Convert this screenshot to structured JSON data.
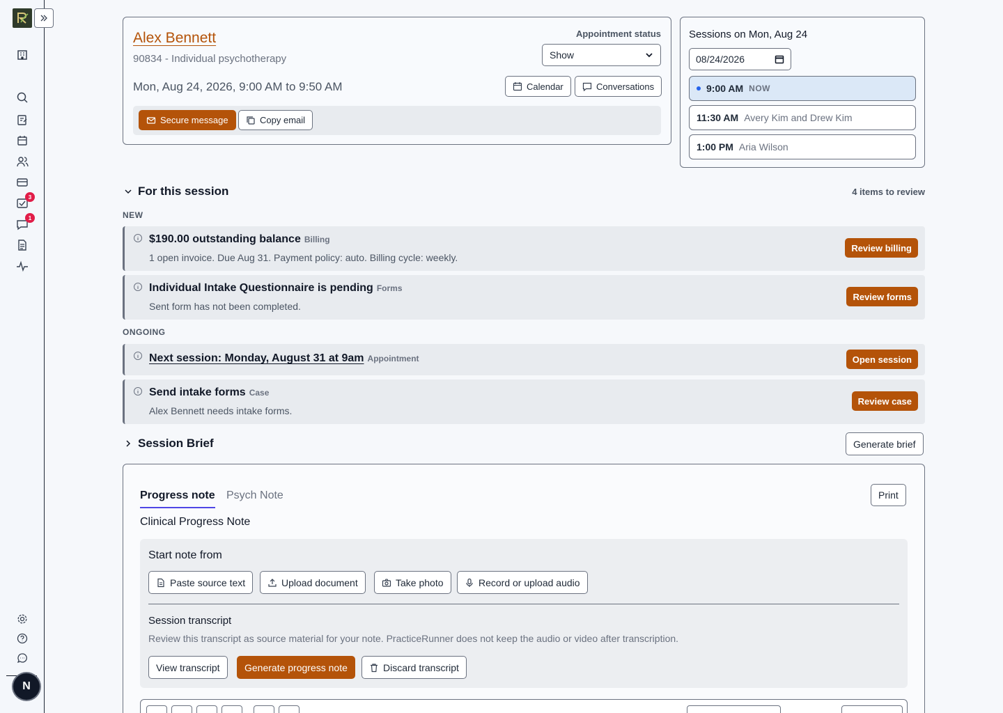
{
  "sidebar": {
    "logo_letter": "R",
    "badges": {
      "tasks": "3",
      "messages": "1"
    },
    "avatar_initial": "N",
    "icons": [
      "building-icon",
      "search-icon",
      "notes-icon",
      "calendar-icon",
      "clients-icon",
      "billing-icon",
      "tasks-icon",
      "messages-icon",
      "documents-icon",
      "activity-icon",
      "settings-icon",
      "help-icon",
      "feedback-icon"
    ]
  },
  "appointment": {
    "client_name": "Alex Bennett",
    "service": "90834 - Individual psychotherapy",
    "datetime": "Mon, Aug 24, 2026, 9:00 AM to 9:50 AM",
    "status_label": "Appointment status",
    "status_value": "Show",
    "calendar_label": "Calendar",
    "conversations_label": "Conversations",
    "secure_message_label": "Secure message",
    "copy_email_label": "Copy email"
  },
  "sessions": {
    "title": "Sessions on Mon, Aug 24",
    "date_value": "08/24/2026",
    "items": [
      {
        "time": "9:00 AM",
        "client": "",
        "now_label": "NOW"
      },
      {
        "time": "11:30 AM",
        "client": "Avery Kim and Drew Kim",
        "now_label": ""
      },
      {
        "time": "1:00 PM",
        "client": "Aria Wilson",
        "now_label": ""
      }
    ]
  },
  "review": {
    "section_title": "For this session",
    "count_label": "4 items to review",
    "new_label": "NEW",
    "ongoing_label": "ONGOING",
    "items": [
      {
        "title": "$190.00 outstanding balance",
        "tag": "Billing",
        "desc": "1 open invoice. Due Aug 31. Payment policy: auto. Billing cycle: weekly.",
        "action": "Review billing"
      },
      {
        "title": "Individual Intake Questionnaire is pending",
        "tag": "Forms",
        "desc": "Sent form has not been completed.",
        "action": "Review forms"
      },
      {
        "title": "Next session: Monday, August 31 at 9am",
        "tag": "Appointment",
        "desc": "",
        "action": "Open session"
      },
      {
        "title": "Send intake forms",
        "tag": "Case",
        "desc": "Alex Bennett needs intake forms.",
        "action": "Review case"
      }
    ]
  },
  "brief": {
    "title": "Session Brief",
    "generate_label": "Generate brief"
  },
  "note": {
    "tabs": [
      "Progress note",
      "Psych Note"
    ],
    "print_label": "Print",
    "heading": "Clinical Progress Note",
    "start_from_label": "Start note from",
    "sources": [
      "Paste source text",
      "Upload document",
      "Take photo",
      "Record or upload audio"
    ],
    "transcript_title": "Session transcript",
    "transcript_desc": "Review this transcript as source material for your note. PracticeRunner does not keep the audio or video after transcription.",
    "view_transcript": "View transcript",
    "generate_note": "Generate progress note",
    "discard_transcript": "Discard transcript"
  },
  "colors": {
    "accent": "#b45309",
    "now_dot": "#2563eb",
    "badge": "#e11d48"
  }
}
